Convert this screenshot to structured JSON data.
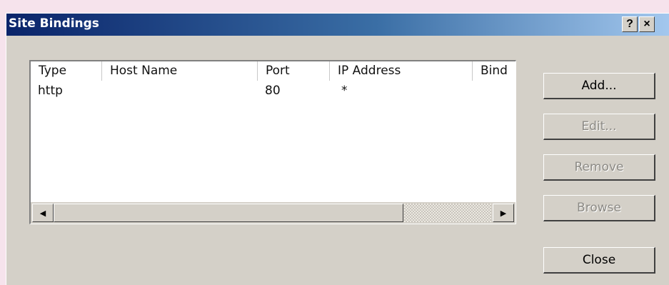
{
  "window": {
    "title": "Site Bindings",
    "help_button": "?",
    "close_button": "×"
  },
  "bindings_list": {
    "columns": [
      "Type",
      "Host Name",
      "Port",
      "IP Address",
      "Bind"
    ],
    "rows": [
      {
        "type": "http",
        "host_name": "",
        "port": "80",
        "ip_address": "*",
        "bind": ""
      }
    ]
  },
  "scrollbar": {
    "left_arrow_icon": "scroll-left-arrow-icon",
    "right_arrow_icon": "scroll-right-arrow-icon"
  },
  "buttons": {
    "add": "Add...",
    "edit": "Edit...",
    "remove": "Remove",
    "browse": "Browse",
    "close": "Close"
  }
}
